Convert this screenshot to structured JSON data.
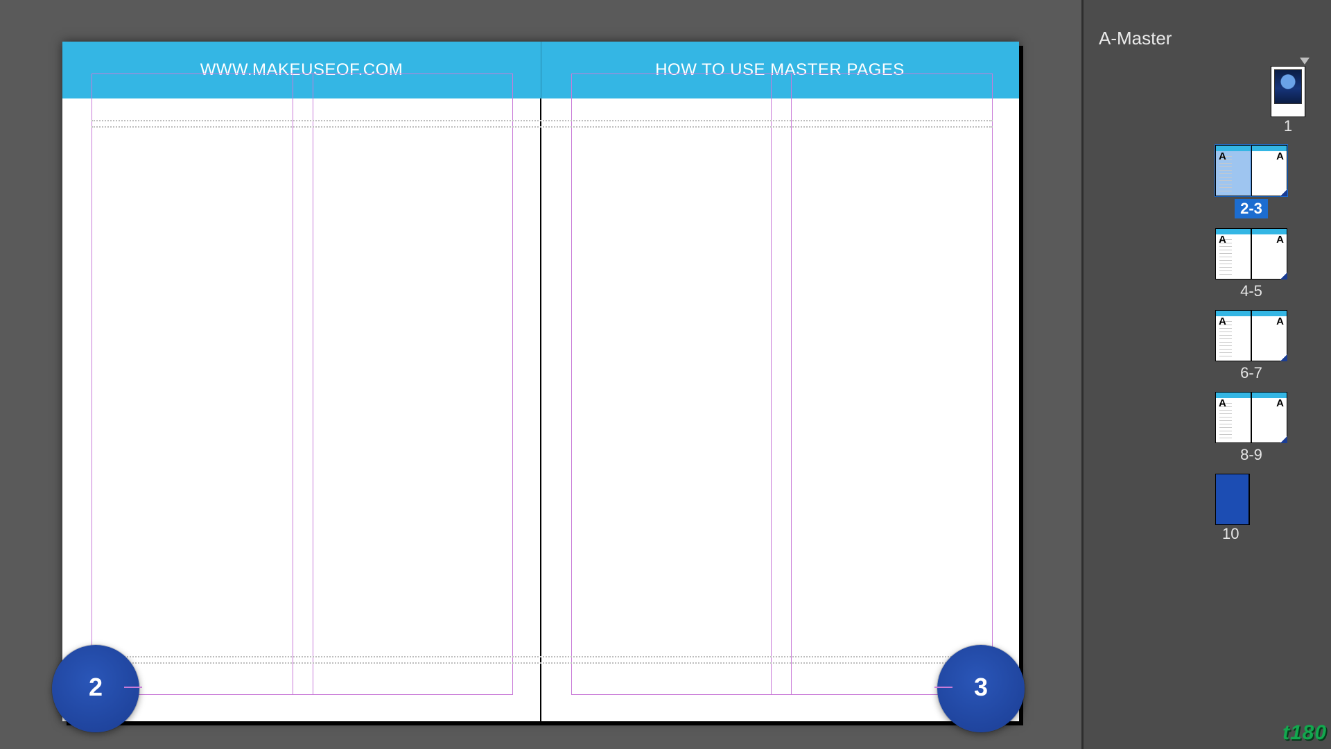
{
  "spread": {
    "leftHeader": "WWW.MAKEUSEOF.COM",
    "rightHeader": "HOW TO USE MASTER PAGES",
    "leftPageNumber": "2",
    "rightPageNumber": "3"
  },
  "panel": {
    "masterName": "A-Master",
    "masterLetter": "A",
    "pages": {
      "p1": "1",
      "p2_3": "2-3",
      "p4_5": "4-5",
      "p6_7": "6-7",
      "p8_9": "8-9",
      "p10": "10"
    },
    "selected": "2-3"
  },
  "watermark": "t180"
}
